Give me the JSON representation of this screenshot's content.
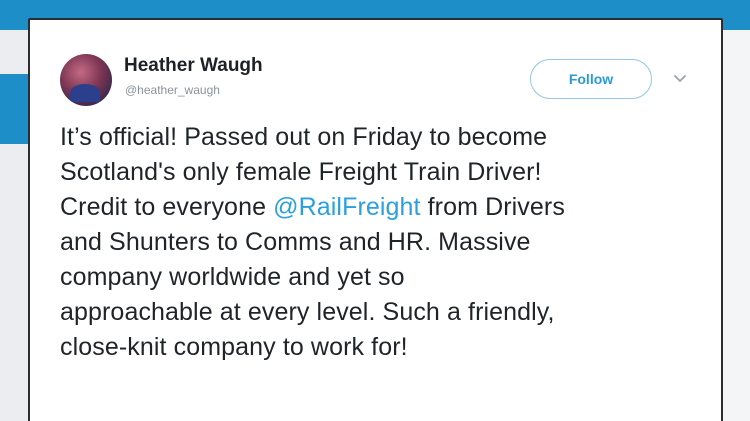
{
  "colors": {
    "accent_blue": "#1e8ec9",
    "mention_blue": "#2ba0dd",
    "follow_blue": "#2a9ad6",
    "text_dark": "#1f2429",
    "handle_gray": "#8a939b"
  },
  "tweet": {
    "author_name": "Heather Waugh",
    "author_handle": "@heather_waugh",
    "follow_label": "Follow",
    "menu_icon": "chevron-down-icon",
    "avatar_icon": "avatar",
    "lines": {
      "l1": "It’s official! Passed out on Friday to become",
      "l2": "Scotland's only female Freight Train Driver!",
      "l3_pre": "Credit to everyone ",
      "l3_mention": "@RailFreight",
      "l3_post": " from Drivers",
      "l4": "and Shunters to Comms and HR. Massive",
      "l5": "company worldwide and yet so",
      "l6": "approachable at every level. Such a friendly,",
      "l7": "close-knit company to work for!"
    }
  }
}
